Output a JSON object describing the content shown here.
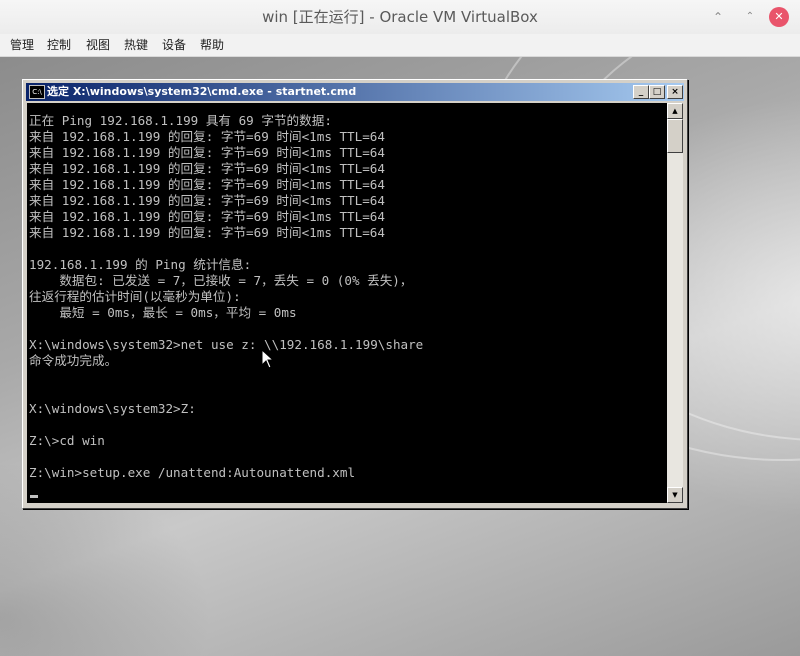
{
  "host": {
    "title": "win [正在运行] - Oracle VM VirtualBox",
    "controls": {
      "minimize": "⌃",
      "restore": "⌃",
      "close": "✕"
    }
  },
  "menubar": {
    "items": [
      "管理",
      "控制",
      "视图",
      "热键",
      "设备",
      "帮助"
    ]
  },
  "cmd": {
    "title": "选定 X:\\windows\\system32\\cmd.exe - startnet.cmd",
    "icon_text": "C:\\",
    "buttons": {
      "minimize": "_",
      "maximize": "□",
      "close": "×"
    },
    "lines": [
      "",
      "正在 Ping 192.168.1.199 具有 69 字节的数据:",
      "来自 192.168.1.199 的回复: 字节=69 时间<1ms TTL=64",
      "来自 192.168.1.199 的回复: 字节=69 时间<1ms TTL=64",
      "来自 192.168.1.199 的回复: 字节=69 时间<1ms TTL=64",
      "来自 192.168.1.199 的回复: 字节=69 时间<1ms TTL=64",
      "来自 192.168.1.199 的回复: 字节=69 时间<1ms TTL=64",
      "来自 192.168.1.199 的回复: 字节=69 时间<1ms TTL=64",
      "来自 192.168.1.199 的回复: 字节=69 时间<1ms TTL=64",
      "",
      "192.168.1.199 的 Ping 统计信息:",
      "    数据包: 已发送 = 7，已接收 = 7，丢失 = 0 (0% 丢失)，",
      "往返行程的估计时间(以毫秒为单位):",
      "    最短 = 0ms，最长 = 0ms，平均 = 0ms",
      "",
      "X:\\windows\\system32>net use z: \\\\192.168.1.199\\share",
      "命令成功完成。",
      "",
      "",
      "X:\\windows\\system32>Z:",
      "",
      "Z:\\>cd win",
      "",
      "Z:\\win>setup.exe /unattend:Autounattend.xml",
      ""
    ],
    "scroll_arrows": {
      "up": "▲",
      "down": "▼"
    }
  }
}
